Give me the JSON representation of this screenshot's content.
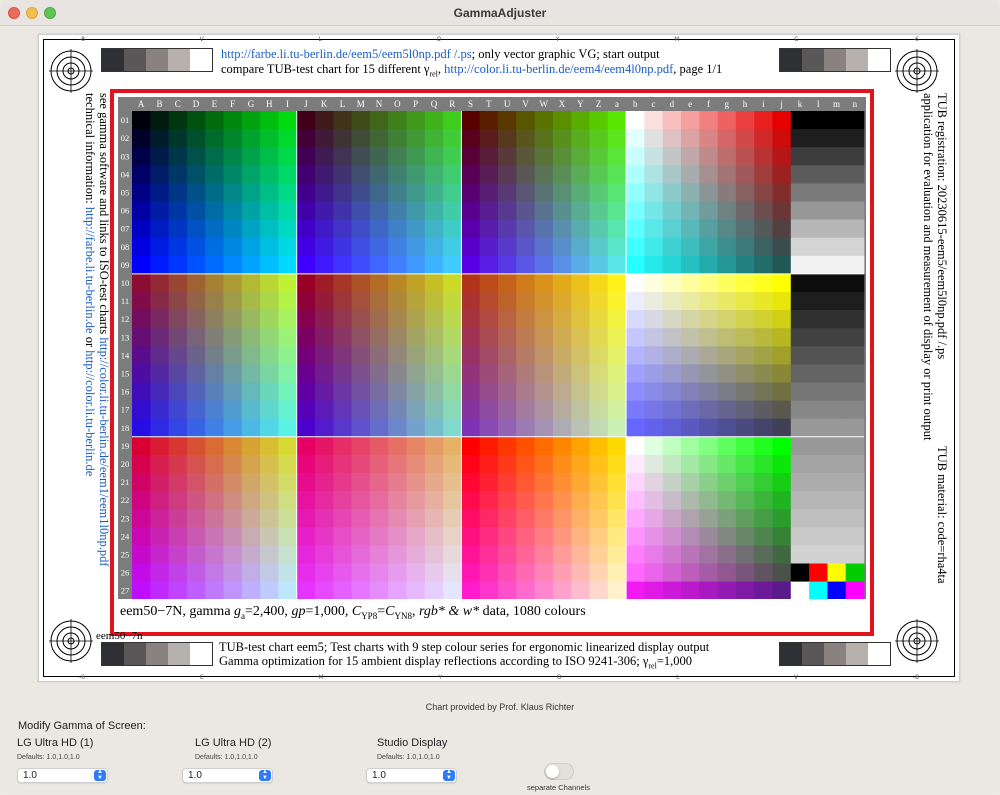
{
  "window": {
    "title": "GammaAdjuster"
  },
  "chart": {
    "header_line1_link": "http://farbe.li.tu-berlin.de/eem5/eem5l0np.pdf /.ps",
    "header_line1_text": "; only vector graphic VG; start output",
    "header_line2_text": "compare TUB-test chart for 15 different γ",
    "header_line2_sub": "rel",
    "header_line2_sep": ", ",
    "header_line2_link": "http://color.li.tu-berlin.de/eem4/eem4l0np.pdf",
    "header_line2_tail": ", page 1/1",
    "left_text_1": "see gamma software and links to ISO-test charts ",
    "left_link_1": "http://color.li.tu-berlin.de/eem1/eem1l0np.pdf",
    "left_text_2": "technical information: ",
    "left_link_2": "http://farbe.li.tu-berlin.de",
    "left_text_3": " or ",
    "left_link_3": "http://color.li.tu-berlin.de",
    "right_text_1": "TUB registration: 20230615-eem5/eem5l0np.pdf /.ps",
    "right_text_2": "application for evaluation and measurement of display or print output",
    "right_text_3": "TUB material: code=rha4ta",
    "footer_line1": "TUB-test chart eem5; Test charts with 9 step colour series for ergonomic linearized display output",
    "footer_line2": "Gamma optimization for 15 ambient display reflections according to ISO 9241-306; γ",
    "footer_line2_sub": "rel",
    "footer_line2_tail": "=1,000",
    "corner_label": "eem50−7n",
    "caption": "eem50−7N, gamma g_a=2,400, gp=1,000, C_YP8=C_YN8, rgb* & w* data, 1080 colours",
    "col_labels": [
      "A",
      "B",
      "C",
      "D",
      "E",
      "F",
      "G",
      "H",
      "I",
      "J",
      "K",
      "L",
      "M",
      "N",
      "O",
      "P",
      "Q",
      "R",
      "S",
      "T",
      "U",
      "V",
      "W",
      "X",
      "Y",
      "Z",
      "a",
      "b",
      "c",
      "d",
      "e",
      "f",
      "g",
      "h",
      "i",
      "j",
      "k",
      "l",
      "m",
      "n"
    ],
    "row_labels": [
      "01",
      "02",
      "03",
      "04",
      "05",
      "06",
      "07",
      "08",
      "09",
      "10",
      "11",
      "12",
      "13",
      "14",
      "15",
      "16",
      "17",
      "18",
      "19",
      "20",
      "21",
      "22",
      "23",
      "24",
      "25",
      "26",
      "27"
    ],
    "edge_top": [
      "-8",
      "V",
      "L",
      "O",
      "Y",
      "M",
      "C",
      "-6"
    ],
    "edge_bottom": [
      "-6",
      "C",
      "M",
      "Y",
      "O",
      "L",
      "V",
      "-8"
    ],
    "gray_strip": [
      "#2e3033",
      "#5a5758",
      "#8a8280",
      "#b7b1ae",
      "#ffffff"
    ],
    "colors": {
      "frame_red": "#e0141c",
      "link_blue": "#1b5ec6",
      "accent": "#2f7cf6"
    }
  },
  "footer": {
    "credit": "Chart provided by Prof. Klaus Richter",
    "modify_label": "Modify Gamma of Screen:",
    "displays": [
      {
        "name": "LG Ultra HD (1)",
        "defaults": "Defaults: 1.0,1.0,1.0",
        "value": "1.0"
      },
      {
        "name": "LG Ultra HD (2)",
        "defaults": "Defaults: 1.0,1.0,1.0",
        "value": "1.0"
      },
      {
        "name": "Studio Display",
        "defaults": "Defaults: 1.0,1.0,1.0",
        "value": "1.0"
      }
    ],
    "toggle_label": "separate Channels",
    "toggle_on": false
  }
}
